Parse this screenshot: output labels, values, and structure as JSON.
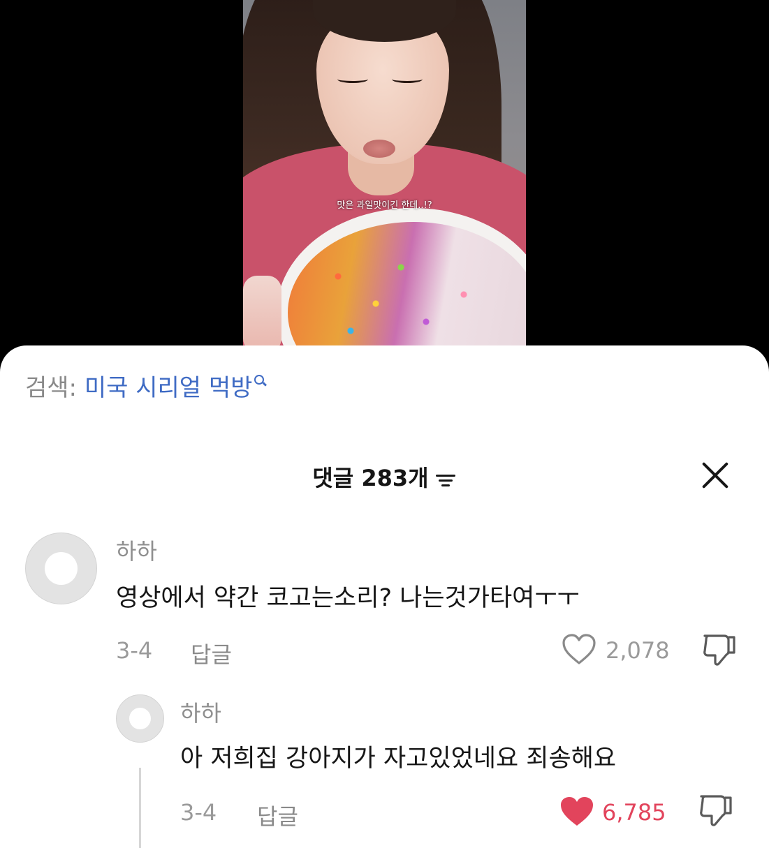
{
  "video": {
    "caption": "맛은 과일맛이긴 한데..!?"
  },
  "search": {
    "prefix": "검색:",
    "query": "미국 시리얼 먹방"
  },
  "comments_header": {
    "title": "댓글 283개"
  },
  "comments": [
    {
      "username": "하하",
      "text": "영상에서 약간 코고는소리? 나는것가타여ㅜㅜ",
      "date": "3-4",
      "reply_label": "답글",
      "likes": "2,078",
      "liked": false
    }
  ],
  "replies": [
    {
      "username": "하하",
      "text": "아 저희집 강아지가 자고있었네요 죄송해요",
      "date": "3-4",
      "reply_label": "답글",
      "likes": "6,785",
      "liked": true
    }
  ],
  "colors": {
    "accent_blue": "#3f6bc4",
    "like_red": "#e2445c"
  }
}
